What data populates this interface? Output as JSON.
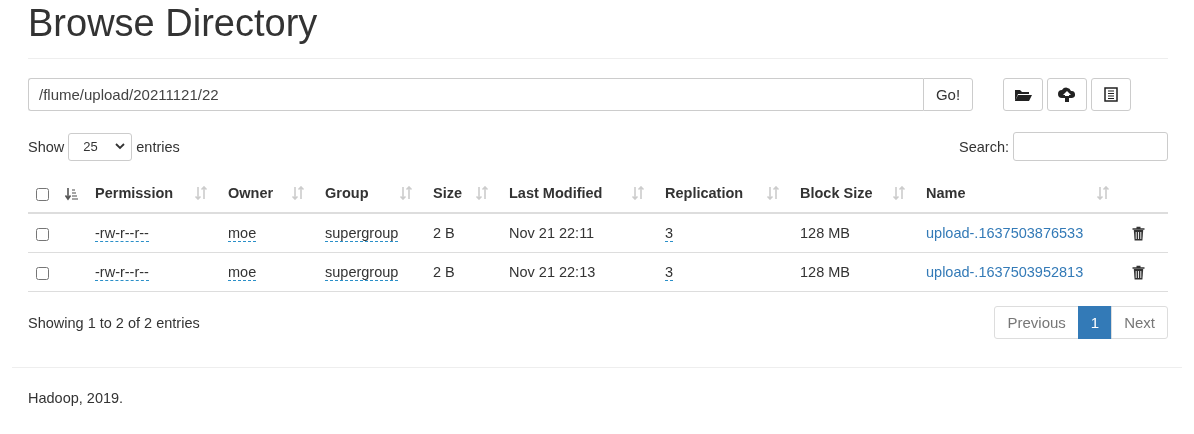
{
  "page_title": "Browse Directory",
  "path_bar": {
    "value": "/flume/upload/20211121/22",
    "go_button": "Go!"
  },
  "length_control": {
    "before": "Show",
    "value": "25",
    "after": "entries"
  },
  "search": {
    "label": "Search:"
  },
  "table": {
    "select_all": {
      "checked": false,
      "sorted": true
    },
    "columns": [
      {
        "label": "Permission",
        "sorted": false
      },
      {
        "label": "Owner",
        "sorted": false
      },
      {
        "label": "Group",
        "sorted": false
      },
      {
        "label": "Size",
        "sorted": false
      },
      {
        "label": "Last Modified",
        "sorted": false
      },
      {
        "label": "Replication",
        "sorted": false
      },
      {
        "label": "Block Size",
        "sorted": false
      },
      {
        "label": "Name",
        "sorted": false
      }
    ],
    "rows": [
      {
        "checked": false,
        "permission": "-rw-r--r--",
        "owner": "moe",
        "group": "supergroup",
        "size": "2 B",
        "last_modified": "Nov 21 22:11",
        "replication": "3",
        "block_size": "128 MB",
        "name": "upload-.1637503876533"
      },
      {
        "checked": false,
        "permission": "-rw-r--r--",
        "owner": "moe",
        "group": "supergroup",
        "size": "2 B",
        "last_modified": "Nov 21 22:13",
        "replication": "3",
        "block_size": "128 MB",
        "name": "upload-.1637503952813"
      }
    ]
  },
  "info": "Showing 1 to 2 of 2 entries",
  "pagination": {
    "previous": "Previous",
    "next": "Next",
    "pages": [
      {
        "label": "1",
        "selected": true
      }
    ]
  },
  "footer": "Hadoop, 2019."
}
